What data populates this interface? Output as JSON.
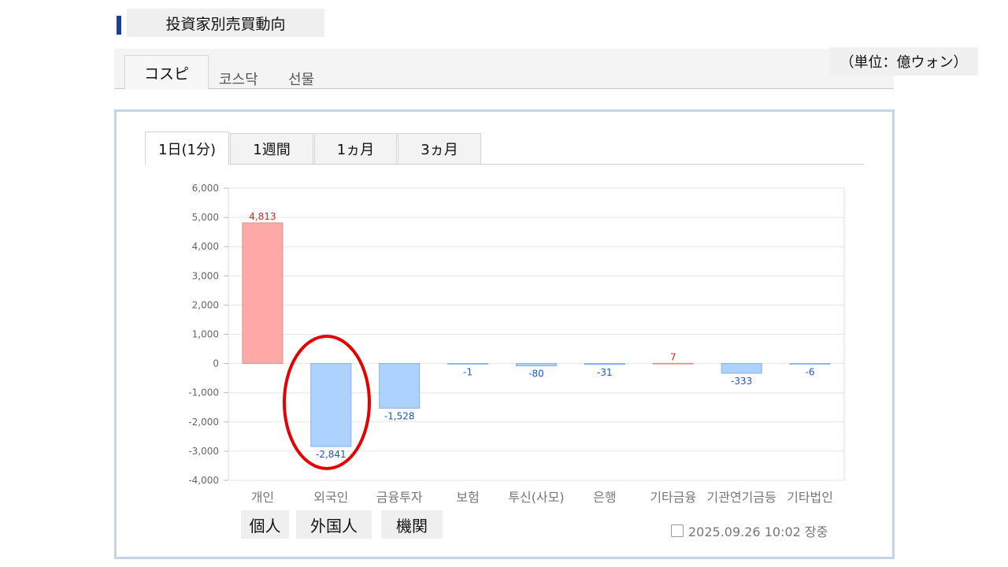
{
  "page_title": "投資家別売買動向",
  "unit": "（単位：億ウォン）",
  "market_tabs": [
    "コスピ",
    "코스닥",
    "선물"
  ],
  "period_tabs": [
    "1日(1分)",
    "1週間",
    "1ヵ月",
    "3ヵ月"
  ],
  "annotations": [
    "個人",
    "外国人",
    "機関"
  ],
  "timestamp": "2025.09.26 10:02 장중",
  "colors": {
    "positive": "#ffa8a8",
    "positive_border": "#ef8a8a",
    "negative": "#aed2ff",
    "negative_border": "#7fb0ee",
    "positive_label": "#e02020",
    "negative_label": "#1c57c8",
    "highlight": "#e60000"
  },
  "chart_data": {
    "type": "bar",
    "categories": [
      "개인",
      "외국인",
      "금융투자",
      "보험",
      "투신(사모)",
      "은행",
      "기타금융",
      "기관연기금등",
      "기타법인"
    ],
    "values": [
      4813,
      -2841,
      -1528,
      -1,
      -80,
      -31,
      7,
      -333,
      -6
    ],
    "value_labels": [
      "4,813",
      "-2,841",
      "-1,528",
      "-1",
      "-80",
      "-31",
      "7",
      "-333",
      "-6"
    ],
    "ylim": [
      -4000,
      6000
    ],
    "yticks": [
      6000,
      5000,
      4000,
      3000,
      2000,
      1000,
      0,
      -1000,
      -2000,
      -3000,
      -4000
    ],
    "ytick_labels": [
      "6,000",
      "5,000",
      "4,000",
      "3,000",
      "2,000",
      "1,000",
      "0",
      "-1,000",
      "-2,000",
      "-3,000",
      "-4,000"
    ],
    "grid": true,
    "highlighted_category": "외국인"
  }
}
